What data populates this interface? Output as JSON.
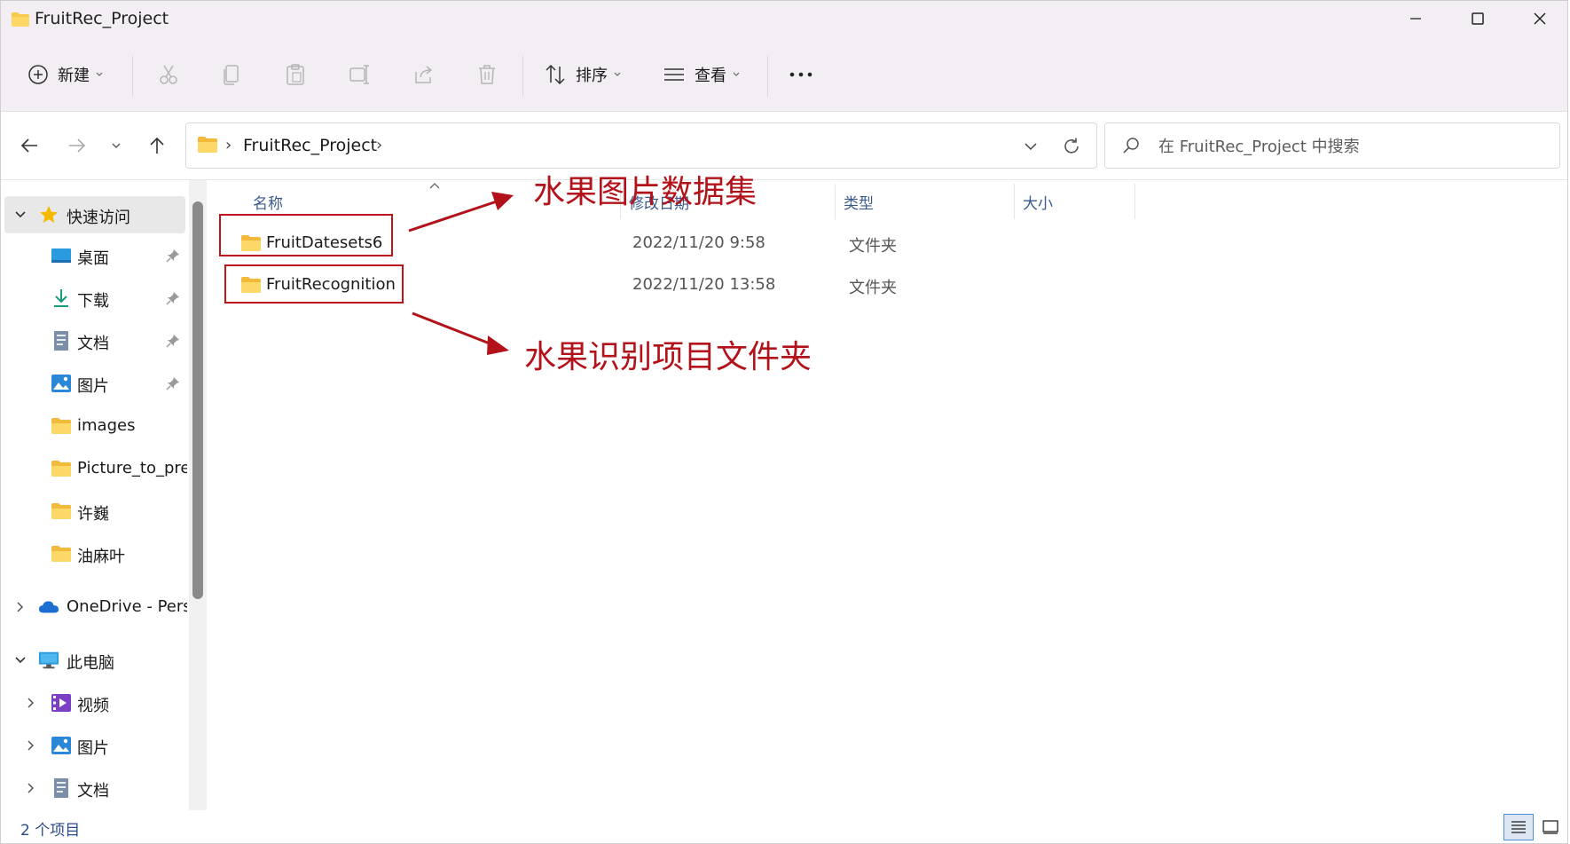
{
  "window": {
    "title": "FruitRec_Project"
  },
  "toolbar": {
    "new_label": "新建",
    "sort_label": "排序",
    "view_label": "查看"
  },
  "address": {
    "crumb": "FruitRec_Project",
    "search_placeholder": "在 FruitRec_Project 中搜索"
  },
  "sidebar": {
    "quick_access": "快速访问",
    "items": [
      {
        "label": "桌面",
        "pinned": true,
        "icon": "desktop-icon"
      },
      {
        "label": "下载",
        "pinned": true,
        "icon": "download-icon"
      },
      {
        "label": "文档",
        "pinned": true,
        "icon": "document-icon"
      },
      {
        "label": "图片",
        "pinned": true,
        "icon": "pictures-icon"
      },
      {
        "label": "images",
        "pinned": false,
        "icon": "folder-icon"
      },
      {
        "label": "Picture_to_pre",
        "pinned": false,
        "icon": "folder-icon"
      },
      {
        "label": "许巍",
        "pinned": false,
        "icon": "folder-icon"
      },
      {
        "label": "油麻叶",
        "pinned": false,
        "icon": "folder-icon"
      }
    ],
    "onedrive": "OneDrive - Pers",
    "this_pc": "此电脑",
    "pc_items": [
      {
        "label": "视频",
        "icon": "videos-icon"
      },
      {
        "label": "图片",
        "icon": "pictures-icon"
      },
      {
        "label": "文档",
        "icon": "document-icon"
      }
    ]
  },
  "columns": {
    "name": "名称",
    "modified": "修改日期",
    "type": "类型",
    "size": "大小"
  },
  "files": [
    {
      "name": "FruitDatesets6",
      "modified": "2022/11/20 9:58",
      "type": "文件夹"
    },
    {
      "name": "FruitRecognition",
      "modified": "2022/11/20 13:58",
      "type": "文件夹"
    }
  ],
  "annotations": {
    "dataset": "水果图片数据集",
    "project": "水果识别项目文件夹",
    "color": "#c0141c"
  },
  "status": {
    "item_count": "2 个项目"
  },
  "colors": {
    "titlebar_bg": "#f3eef3",
    "folder_yellow": "#f8c94a",
    "accent_blue": "#2b6cd4"
  }
}
